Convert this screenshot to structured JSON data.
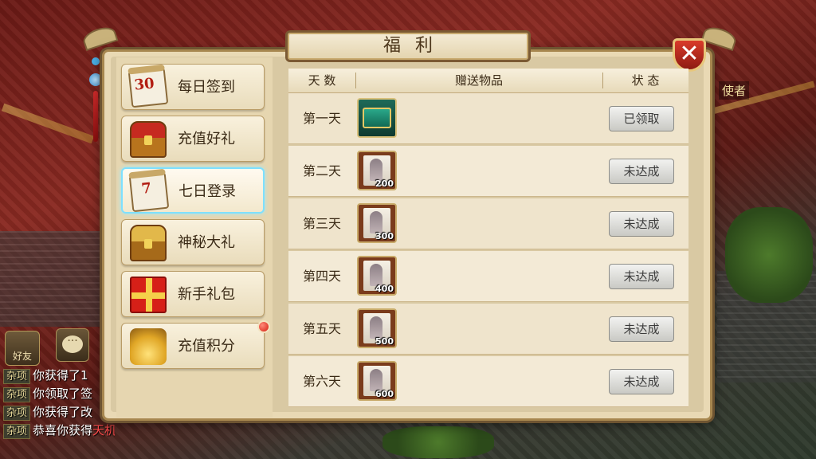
{
  "scene": {
    "npc_label": "使者",
    "chat": {
      "friend_button": "好友",
      "lines": [
        {
          "tag": "杂项",
          "text": "你获得了1"
        },
        {
          "tag": "杂项",
          "text": "你领取了签"
        },
        {
          "tag": "杂项",
          "text": "你获得了改"
        },
        {
          "tag": "杂项",
          "text": "恭喜你获得",
          "highlight": "天机锁链"
        }
      ]
    }
  },
  "dialog": {
    "title": "福利",
    "close_label": "✕",
    "sidebar": {
      "items": [
        {
          "label": "每日签到",
          "icon": "calendar-30-icon",
          "icon_text": "30"
        },
        {
          "label": "充值好礼",
          "icon": "treasure-chest-icon"
        },
        {
          "label": "七日登录",
          "icon": "calendar-7-icon",
          "icon_text": "7",
          "active": true
        },
        {
          "label": "神秘大礼",
          "icon": "mystery-chest-icon"
        },
        {
          "label": "新手礼包",
          "icon": "gift-box-icon"
        },
        {
          "label": "充值积分",
          "icon": "gold-chest-icon",
          "badge": true
        }
      ]
    },
    "table": {
      "headers": [
        "天 数",
        "赠送物品",
        "状 态"
      ],
      "rows": [
        {
          "day": "第一天",
          "item": "jade-chest",
          "qty": "",
          "status": "已领取"
        },
        {
          "day": "第二天",
          "item": "scroll-card",
          "qty": "200",
          "status": "未达成"
        },
        {
          "day": "第三天",
          "item": "scroll-card",
          "qty": "300",
          "status": "未达成"
        },
        {
          "day": "第四天",
          "item": "scroll-card",
          "qty": "400",
          "status": "未达成"
        },
        {
          "day": "第五天",
          "item": "scroll-card",
          "qty": "500",
          "status": "未达成"
        },
        {
          "day": "第六天",
          "item": "scroll-card",
          "qty": "600",
          "status": "未达成"
        }
      ]
    }
  },
  "colors": {
    "accent_active_border": "#7ee0ff",
    "close_button": "#d93a2a",
    "badge": "#d41e10",
    "chat_highlight": "#ff4d4d"
  }
}
